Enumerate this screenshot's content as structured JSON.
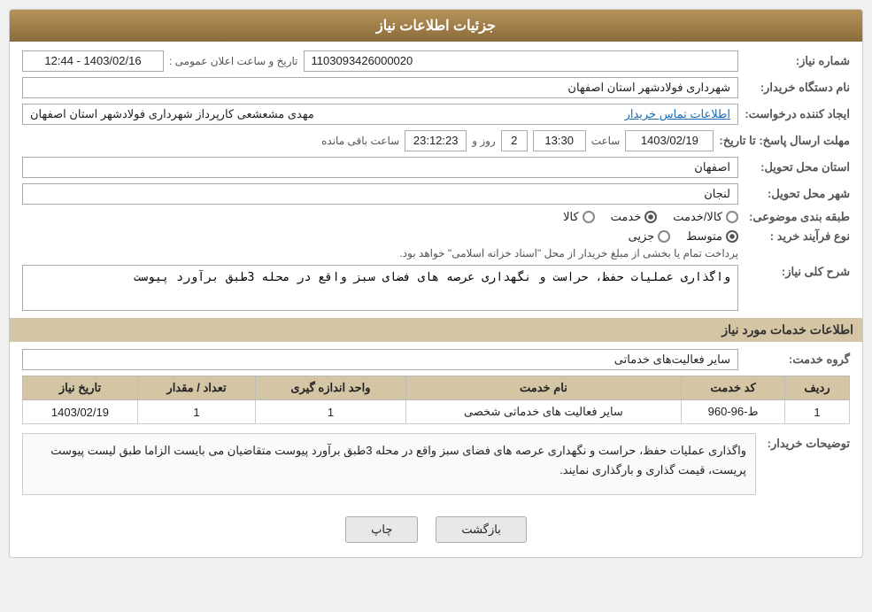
{
  "header": {
    "title": "جزئیات اطلاعات نیاز"
  },
  "fields": {
    "shomareNiaz_label": "شماره نیاز:",
    "shomareNiaz_value": "1103093426000020",
    "namDastgah_label": "نام دستگاه خریدار:",
    "namDastgah_value": "شهرداری فولادشهر استان اصفهان",
    "ijadKonande_label": "ایجاد کننده درخواست:",
    "ijadKonande_value": "مهدی مشعشعی کارپرداز شهرداری فولادشهر استان اصفهان",
    "ijadKonande_link": "اطلاعات تماس خریدار",
    "mohlat_label": "مهلت ارسال پاسخ: تا تاریخ:",
    "mohlat_date": "1403/02/19",
    "mohlat_time_label": "ساعت",
    "mohlat_time": "13:30",
    "mohlat_rooz_label": "روز و",
    "mohlat_rooz": "2",
    "mohlat_countdown_label": "ساعت باقی مانده",
    "mohlat_countdown": "23:12:23",
    "ostan_label": "استان محل تحویل:",
    "ostan_value": "اصفهان",
    "shahr_label": "شهر محل تحویل:",
    "shahr_value": "لنجان",
    "tabaqeBandi_label": "طبقه بندی موضوعی:",
    "tabaqe_options": [
      "کالا",
      "خدمت",
      "کالا/خدمت"
    ],
    "tabaqe_selected": 1,
    "noeFarayand_label": "نوع فرآیند خرید :",
    "noeFarayand_options": [
      "جزیی",
      "متوسط"
    ],
    "noeFarayand_selected": 1,
    "noeFarayand_note": "پرداخت تمام یا بخشی از مبلغ خریدار از محل \"اسناد خزانه اسلامی\" خواهد بود.",
    "sharhNiaz_label": "شرح کلی نیاز:",
    "sharhNiaz_value": "واگذاری عملیات حفظ، حراست و نگهداری عرصه های فضای سبز واقع در محله 3طبق برآورد پیوست",
    "services_section_label": "اطلاعات خدمات مورد نیاز",
    "grohKhadamat_label": "گروه خدمت:",
    "grohKhadamat_value": "سایر فعالیت‌های خدماتی",
    "table": {
      "headers": [
        "ردیف",
        "کد خدمت",
        "نام خدمت",
        "واحد اندازه گیری",
        "تعداد / مقدار",
        "تاریخ نیاز"
      ],
      "rows": [
        [
          "1",
          "ط-96-960",
          "سایر فعالیت های خدماتی شخصی",
          "1",
          "1",
          "1403/02/19"
        ]
      ]
    },
    "tosihKharidar_label": "توضیحات خریدار:",
    "tosihKharidar_value": "واگذاری عملیات حفظ، حراست و نگهداری عرصه های فضای سبز واقع در محله 3طبق برآورد پیوست متقاضیان می بایست الزاما طبق لیست پیوست پریست، قیمت گذاری و بارگذاری نمایند.",
    "btn_back": "بازگشت",
    "btn_print": "چاپ"
  }
}
